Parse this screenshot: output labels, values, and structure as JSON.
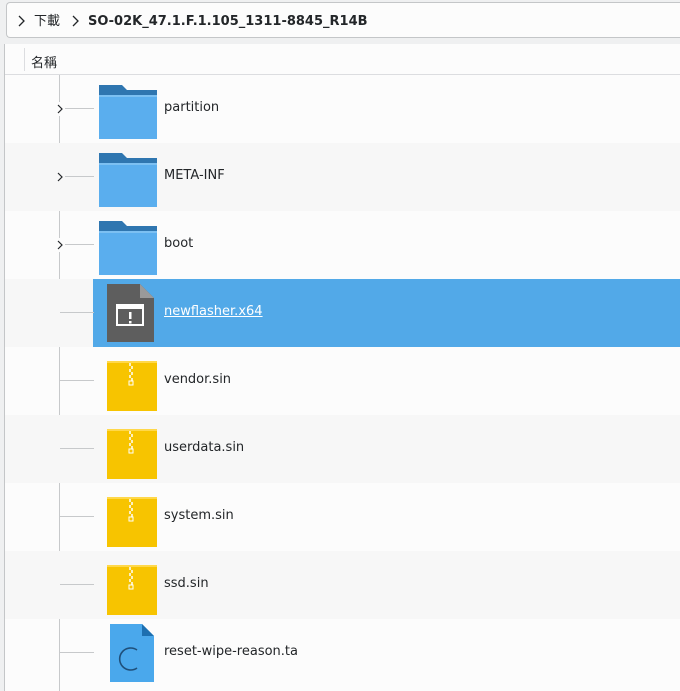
{
  "breadcrumb": {
    "parent": "下載",
    "current": "SO-02K_47.1.F.1.105_1311-8845_R14B"
  },
  "column_header": {
    "name_label": "名稱"
  },
  "files": [
    {
      "name": "partition",
      "type": "folder",
      "expandable": true,
      "selected": false
    },
    {
      "name": "META-INF",
      "type": "folder",
      "expandable": true,
      "selected": false
    },
    {
      "name": "boot",
      "type": "folder",
      "expandable": true,
      "selected": false
    },
    {
      "name": "newflasher.x64",
      "type": "executable",
      "expandable": false,
      "selected": true
    },
    {
      "name": "vendor.sin",
      "type": "archive",
      "expandable": false,
      "selected": false
    },
    {
      "name": "userdata.sin",
      "type": "archive",
      "expandable": false,
      "selected": false
    },
    {
      "name": "system.sin",
      "type": "archive",
      "expandable": false,
      "selected": false
    },
    {
      "name": "ssd.sin",
      "type": "archive",
      "expandable": false,
      "selected": false
    },
    {
      "name": "reset-wipe-reason.ta",
      "type": "source-file",
      "expandable": false,
      "selected": false
    }
  ],
  "colors": {
    "selection": "#52a9e8",
    "folder": "#5aaeee",
    "folder_tab": "#2f76b0",
    "archive": "#f7c400",
    "executable": "#5e5e5e",
    "source_file": "#4aa8ec"
  }
}
